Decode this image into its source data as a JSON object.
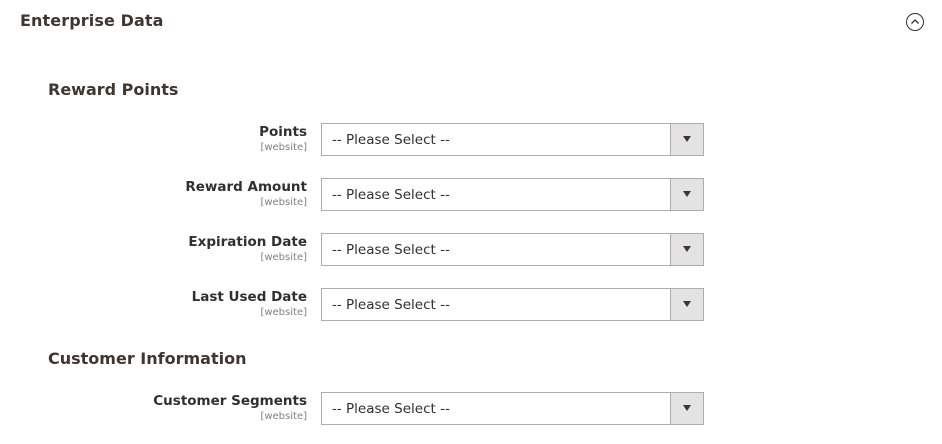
{
  "section": {
    "title": "Enterprise Data",
    "collapse_icon": "chevron-up-circle-icon"
  },
  "groups": [
    {
      "title": "Reward Points",
      "fields": [
        {
          "label": "Points",
          "scope": "[website]",
          "value": "-- Please Select --"
        },
        {
          "label": "Reward Amount",
          "scope": "[website]",
          "value": "-- Please Select --"
        },
        {
          "label": "Expiration Date",
          "scope": "[website]",
          "value": "-- Please Select --"
        },
        {
          "label": "Last Used Date",
          "scope": "[website]",
          "value": "-- Please Select --"
        }
      ]
    },
    {
      "title": "Customer Information",
      "fields": [
        {
          "label": "Customer Segments",
          "scope": "[website]",
          "value": "-- Please Select --"
        }
      ]
    }
  ],
  "colors": {
    "title_text": "#41362f",
    "label_text": "#303030",
    "scope_text": "#808080",
    "select_border": "#adadad",
    "arrow_button_bg": "#e3e3e3"
  },
  "icons": {
    "dropdown_arrow": "triangle-down-icon"
  }
}
